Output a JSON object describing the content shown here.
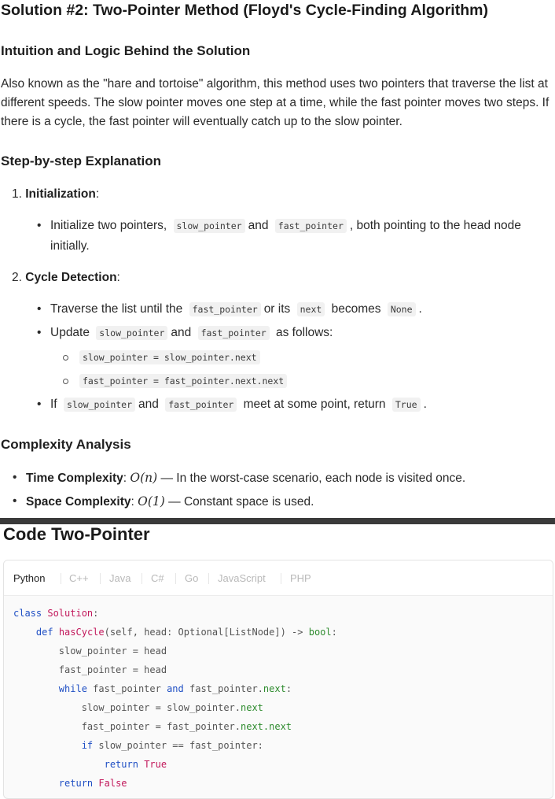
{
  "solution": {
    "title": "Solution #2: Two-Pointer Method (Floyd's Cycle-Finding Algorithm)",
    "intuition_heading": "Intuition and Logic Behind the Solution",
    "intuition_text": "Also known as the \"hare and tortoise\" algorithm, this method uses two pointers that traverse the list at different speeds. The slow pointer moves one step at a time, while the fast pointer moves two steps. If there is a cycle, the fast pointer will eventually catch up to the slow pointer.",
    "steps_heading": "Step-by-step Explanation",
    "step1": {
      "number": "1.",
      "label": "Initialization",
      "colon": ":",
      "bullet": {
        "pre": "Initialize two pointers,",
        "code1": "slow_pointer",
        "mid": "and",
        "code2": "fast_pointer",
        "post": ", both pointing to the head node",
        "cont": "initially."
      }
    },
    "step2": {
      "number": "2.",
      "label": "Cycle Detection",
      "colon": ":",
      "b1": {
        "pre": "Traverse the list until the",
        "code1": "fast_pointer",
        "mid": "or its",
        "code2": "next",
        "mid2": "becomes",
        "code3": "None",
        "post": "."
      },
      "b2": {
        "pre": "Update",
        "code1": "slow_pointer",
        "mid": "and",
        "code2": "fast_pointer",
        "post": "as follows:"
      },
      "sub1": "slow_pointer = slow_pointer.next",
      "sub2": "fast_pointer = fast_pointer.next.next",
      "b3": {
        "pre": "If",
        "code1": "slow_pointer",
        "mid": "and",
        "code2": "fast_pointer",
        "mid2": "meet at some point, return",
        "code3": "True",
        "post": "."
      }
    },
    "complexity_heading": "Complexity Analysis",
    "time": {
      "label": "Time Complexity",
      "colon": ":",
      "math": "O(n)",
      "text": "— In the worst-case scenario, each node is visited once."
    },
    "space": {
      "label": "Space Complexity",
      "colon": ":",
      "math": "O(1)",
      "text": "— Constant space is used."
    }
  },
  "code_section": {
    "title": "Code Two-Pointer",
    "tabs": [
      "Python",
      "C++",
      "Java",
      "C#",
      "Go",
      "JavaScript",
      "PHP"
    ],
    "active_tab": "Python",
    "lines": {
      "l1_kw": "class",
      "l1_name": "Solution",
      "l1_end": ":",
      "l2_kw": "def",
      "l2_fn": "hasCycle",
      "l2_args": "(self, head: Optional[ListNode]) -> ",
      "l2_ty": "bool",
      "l2_end": ":",
      "l3": "slow_pointer = head",
      "l4": "fast_pointer = head",
      "l5_kw": "while",
      "l5_a": " fast_pointer ",
      "l5_and": "and",
      "l5_b": " fast_pointer.",
      "l5_attr": "next",
      "l5_end": ":",
      "l6_a": "slow_pointer = slow_pointer.",
      "l6_attr": "next",
      "l7_a": "fast_pointer = fast_pointer.",
      "l7_attr": "next.next",
      "l8_kw": "if",
      "l8_rest": " slow_pointer == fast_pointer:",
      "l9_kw": "return",
      "l9_val": "True",
      "l10_kw": "return",
      "l10_val": "False"
    }
  }
}
